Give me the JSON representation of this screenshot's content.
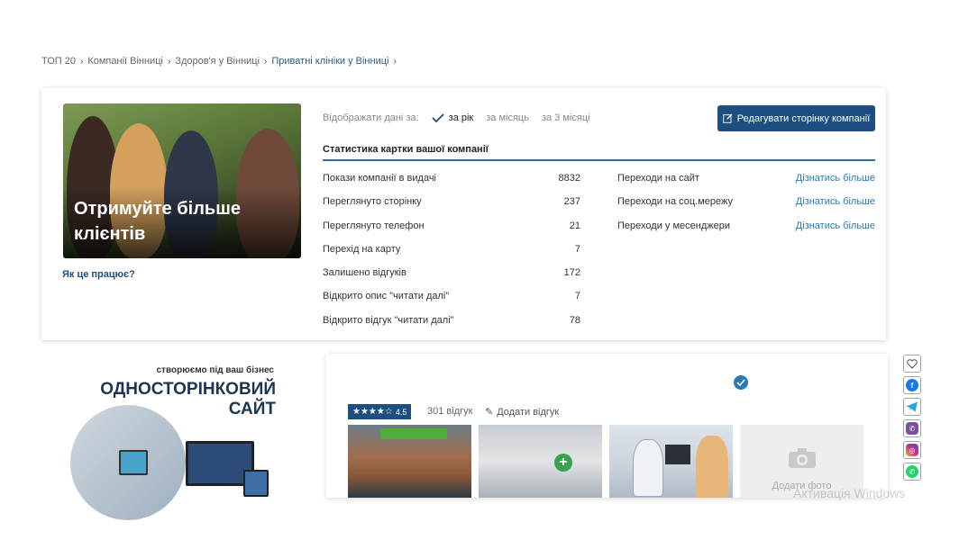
{
  "breadcrumb": [
    {
      "label": "ТОП 20",
      "current": false
    },
    {
      "label": "Компанії Вінниці",
      "current": false
    },
    {
      "label": "Здоров'я у Вінниці",
      "current": false
    },
    {
      "label": "Приватні клініки у Вінниці",
      "current": true
    }
  ],
  "promo": {
    "title": "Отримуйте більше клієнтів",
    "how_link": "Як це працює?"
  },
  "period": {
    "label": "Відображати дані за:",
    "options": [
      {
        "label": "за рік",
        "active": true
      },
      {
        "label": "за місяць",
        "active": false
      },
      {
        "label": "за 3 місяці",
        "active": false
      }
    ]
  },
  "edit_button": {
    "label": "Редагувати сторінку компанії",
    "icon": "edit-icon"
  },
  "stats": {
    "title": "Статистика картки вашої компанії",
    "rows": [
      {
        "label": "Покази компанії в видачі",
        "value": "8832"
      },
      {
        "label": "Переглянуто сторінку",
        "value": "237"
      },
      {
        "label": "Переглянуто телефон",
        "value": "21"
      },
      {
        "label": "Перехід на карту",
        "value": "7"
      },
      {
        "label": "Залишено відгуків",
        "value": "172"
      },
      {
        "label": "Відкрито опис \"читати далі\"",
        "value": "7"
      },
      {
        "label": "Відкрито відгук \"читати далі\"",
        "value": "78"
      }
    ],
    "links": [
      {
        "label": "Переходи на сайт",
        "action": "Дізнатись більше"
      },
      {
        "label": "Переходи на соц.мережу",
        "action": "Дізнатись більше"
      },
      {
        "label": "Переходи у месенджери",
        "action": "Дізнатись більше"
      }
    ]
  },
  "ad": {
    "subtitle": "створюємо під ваш бізнес",
    "title_line1": "ОДНОСТОРІНКОВИЙ",
    "title_line2": "САЙТ"
  },
  "listing": {
    "rating_stars": "★★★★☆",
    "rating": "4.5",
    "reviews": "301 відгук",
    "add_review": "Додати відгук",
    "add_photo": "Додати фото",
    "verified_icon": "verified-badge-icon"
  },
  "watermark": "Активація Windows",
  "social": [
    {
      "name": "favorite-icon",
      "color": "#ffffff",
      "glyph": "♡"
    },
    {
      "name": "facebook-icon",
      "color": "#1877f2",
      "glyph": "f"
    },
    {
      "name": "telegram-icon",
      "color": "#2aa3df",
      "glyph": "➤"
    },
    {
      "name": "viber-icon",
      "color": "#7b4fa0",
      "glyph": "✆"
    },
    {
      "name": "instagram-icon",
      "color": "#c13584",
      "glyph": "◎"
    },
    {
      "name": "whatsapp-icon",
      "color": "#25d366",
      "glyph": "✆"
    }
  ],
  "colors": {
    "primary": "#1c4f80",
    "link": "#2a78b6",
    "accent_line": "#2a6fa8"
  }
}
